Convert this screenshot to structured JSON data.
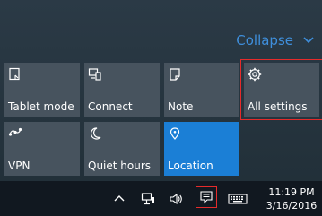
{
  "action_center": {
    "collapse_label": "Collapse",
    "accent": "#1b7fd6",
    "tiles": [
      {
        "label": "Tablet mode",
        "icon": "tablet-mode-icon",
        "active": false
      },
      {
        "label": "Connect",
        "icon": "connect-icon",
        "active": false
      },
      {
        "label": "Note",
        "icon": "note-icon",
        "active": false
      },
      {
        "label": "All settings",
        "icon": "gear-icon",
        "active": false,
        "highlighted": true
      },
      {
        "label": "VPN",
        "icon": "vpn-icon",
        "active": false
      },
      {
        "label": "Quiet hours",
        "icon": "moon-icon",
        "active": false
      },
      {
        "label": "Location",
        "icon": "location-icon",
        "active": true
      }
    ]
  },
  "taskbar": {
    "time": "11:19 PM",
    "date": "3/16/2016",
    "icons": [
      "chevron-up-icon",
      "network-icon",
      "volume-icon",
      "action-center-icon",
      "keyboard-icon"
    ]
  }
}
